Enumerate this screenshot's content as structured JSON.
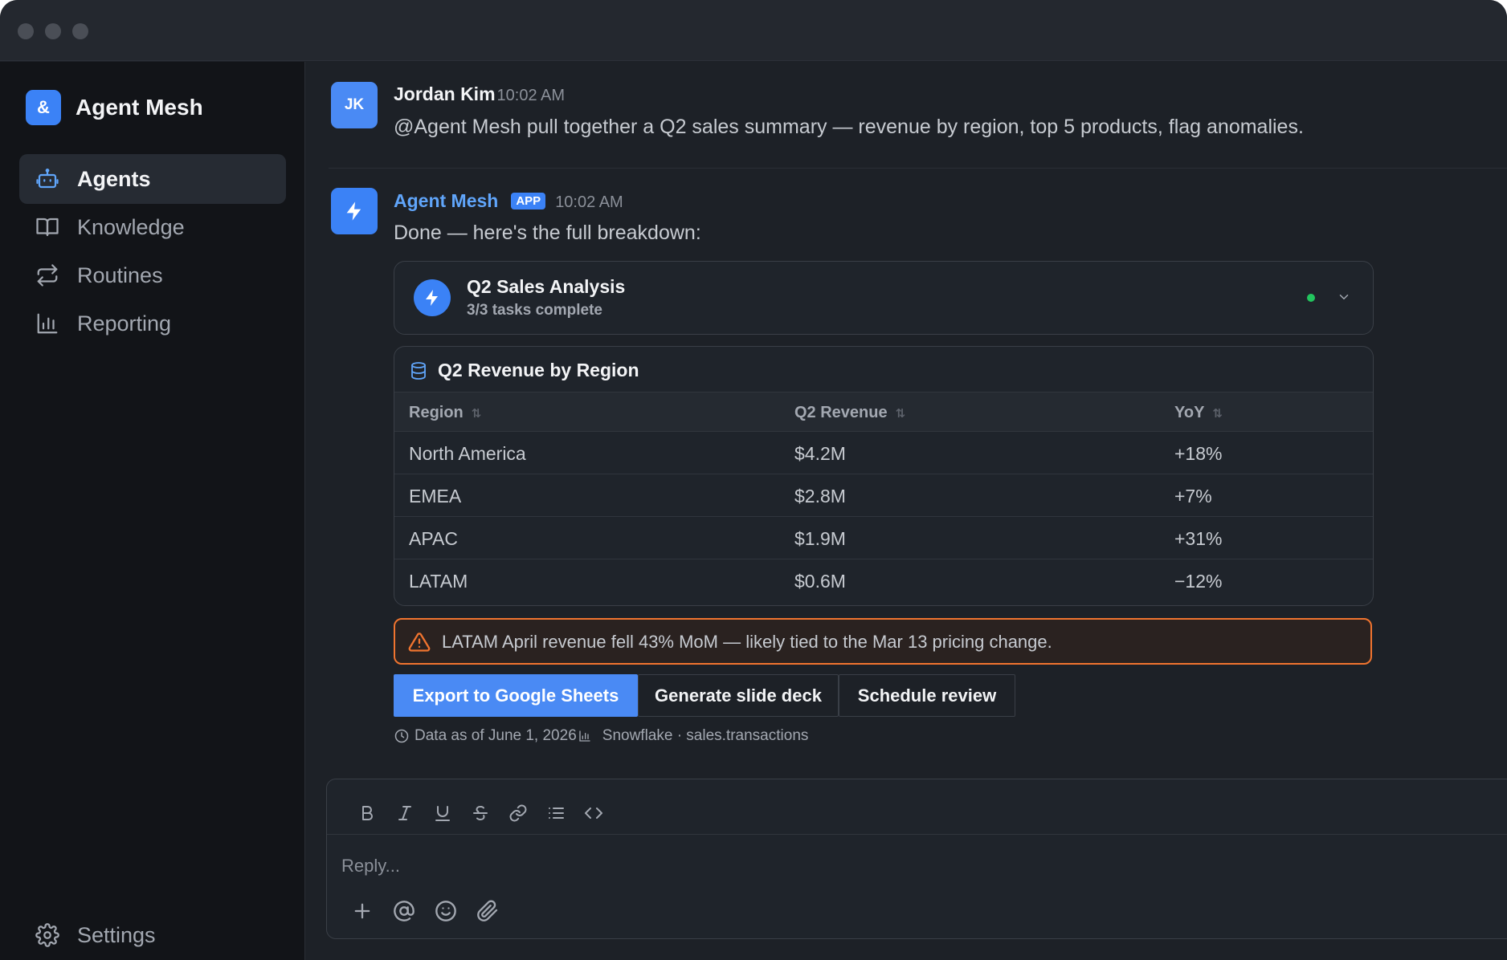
{
  "app": {
    "name": "Agent Mesh",
    "logo_glyph": "&",
    "accent": "#3b82f6"
  },
  "sidebar": {
    "items": [
      {
        "label": "Agents",
        "icon": "robot-icon",
        "active": true
      },
      {
        "label": "Knowledge",
        "icon": "book-icon"
      },
      {
        "label": "Routines",
        "icon": "repeat-icon"
      },
      {
        "label": "Reporting",
        "icon": "bar-chart-icon"
      }
    ],
    "settings_label": "Settings"
  },
  "messages": {
    "user": {
      "initials": "JK",
      "author": "Jordan Kim",
      "time": "10:02 AM",
      "text": "@Agent Mesh pull together a Q2 sales summary — revenue by region, top 5 products, flag anomalies."
    },
    "agent": {
      "author": "Agent Mesh",
      "badge": "APP",
      "time": "10:02 AM",
      "text": "Done — here's the full breakdown:"
    }
  },
  "task": {
    "title": "Q2 Sales Analysis",
    "subtitle": "3/3 tasks complete",
    "status_color": "#22c55e"
  },
  "table": {
    "title": "Q2 Revenue by Region",
    "columns": [
      "Region",
      "Q2 Revenue",
      "YoY"
    ],
    "rows": [
      [
        "North America",
        "$4.2M",
        "+18%"
      ],
      [
        "EMEA",
        "$2.8M",
        "+7%"
      ],
      [
        "APAC",
        "$1.9M",
        "+31%"
      ],
      [
        "LATAM",
        "$0.6M",
        "−12%"
      ]
    ]
  },
  "alert": {
    "text": "LATAM April revenue fell 43% MoM — likely tied to the Mar 13 pricing change.",
    "color": "#f0742f"
  },
  "actions": {
    "export": "Export to Google Sheets",
    "slides": "Generate slide deck",
    "schedule": "Schedule review"
  },
  "meta": {
    "data_as_of": "Data as of June 1, 2026",
    "source": "Snowflake · sales.transactions"
  },
  "composer": {
    "placeholder": "Reply..."
  }
}
